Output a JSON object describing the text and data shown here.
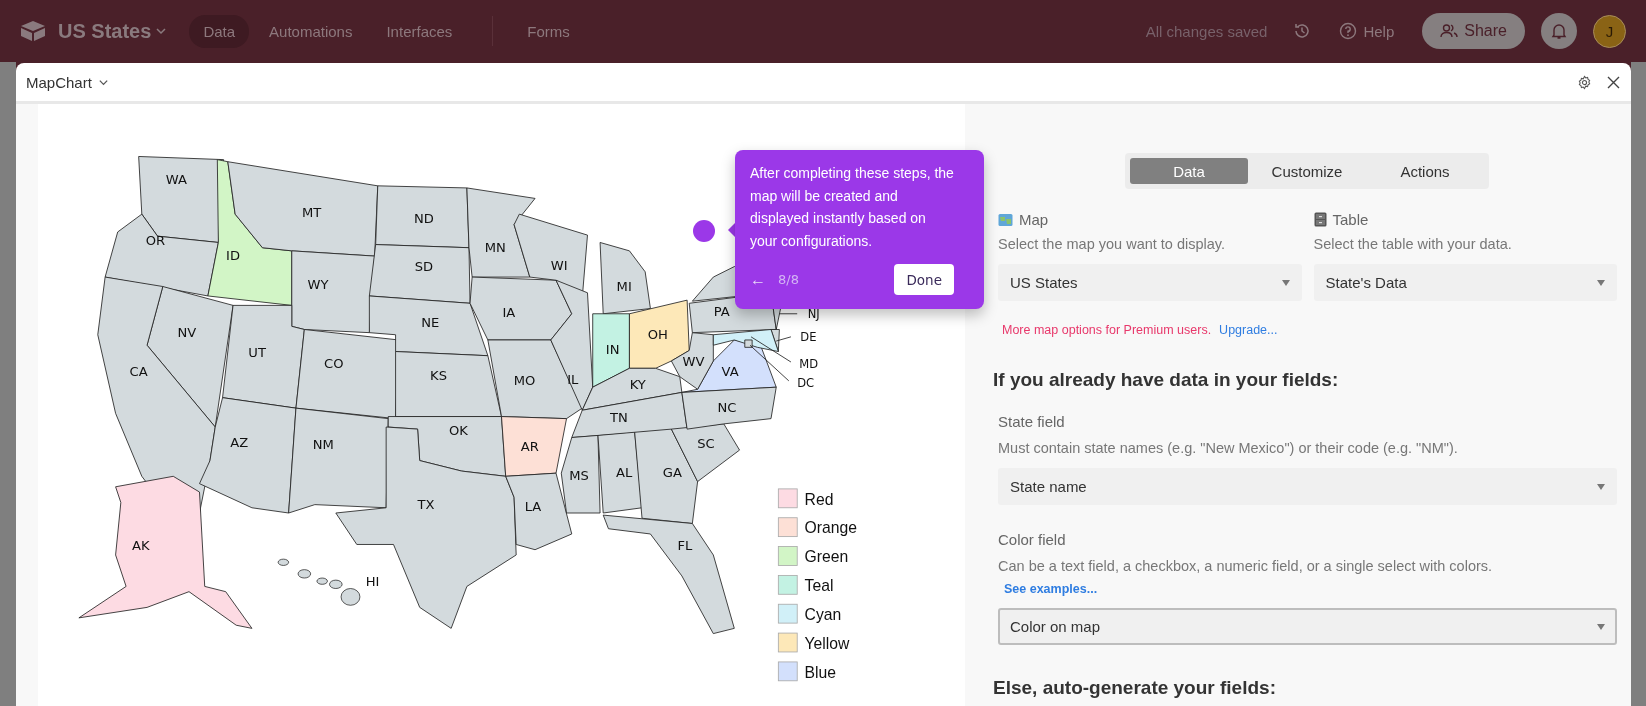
{
  "topbar": {
    "base_name": "US States",
    "nav": [
      {
        "label": "Data",
        "selected": true
      },
      {
        "label": "Automations",
        "selected": false
      },
      {
        "label": "Interfaces",
        "selected": false
      },
      {
        "label": "Forms",
        "selected": false
      }
    ],
    "save_status": "All changes saved",
    "help": "Help",
    "share": "Share",
    "avatar": "J"
  },
  "extension": {
    "title": "MapChart"
  },
  "states": [
    {
      "code": "WA",
      "color": "#d3dadd",
      "kind": "label"
    },
    {
      "code": "OR",
      "color": "#d3dadd",
      "kind": "label"
    },
    {
      "code": "ID",
      "color": "#d2f5c6",
      "kind": "label"
    },
    {
      "code": "MT",
      "color": "#d3dadd",
      "kind": "label"
    },
    {
      "code": "WY",
      "color": "#d3dadd",
      "kind": "label"
    },
    {
      "code": "NV",
      "color": "#d3dadd",
      "kind": "label"
    },
    {
      "code": "CA",
      "color": "#d3dadd",
      "kind": "label"
    },
    {
      "code": "UT",
      "color": "#d3dadd",
      "kind": "label"
    },
    {
      "code": "CO",
      "color": "#d3dadd",
      "kind": "label"
    },
    {
      "code": "AZ",
      "color": "#d3dadd",
      "kind": "label"
    },
    {
      "code": "NM",
      "color": "#d3dadd",
      "kind": "label"
    },
    {
      "code": "ND",
      "color": "#d3dadd",
      "kind": "label"
    },
    {
      "code": "SD",
      "color": "#d3dadd",
      "kind": "label"
    },
    {
      "code": "NE",
      "color": "#d3dadd",
      "kind": "label"
    },
    {
      "code": "KS",
      "color": "#d3dadd",
      "kind": "label"
    },
    {
      "code": "OK",
      "color": "#d3dadd",
      "kind": "label"
    },
    {
      "code": "TX",
      "color": "#d3dadd",
      "kind": "label"
    },
    {
      "code": "MN",
      "color": "#d3dadd",
      "kind": "label"
    },
    {
      "code": "IA",
      "color": "#d3dadd",
      "kind": "label"
    },
    {
      "code": "MO",
      "color": "#d3dadd",
      "kind": "label"
    },
    {
      "code": "AR",
      "color": "#fde0d6",
      "kind": "label"
    },
    {
      "code": "LA",
      "color": "#d3dadd",
      "kind": "label"
    },
    {
      "code": "WI",
      "color": "#d3dadd",
      "kind": "label"
    },
    {
      "code": "IL",
      "color": "#d3dadd",
      "kind": "label"
    },
    {
      "code": "MI",
      "color": "#d3dadd",
      "kind": "label"
    },
    {
      "code": "IN",
      "color": "#c3f2e3",
      "kind": "label"
    },
    {
      "code": "OH",
      "color": "#fde8b8",
      "kind": "label"
    },
    {
      "code": "KY",
      "color": "#d3dadd",
      "kind": "label"
    },
    {
      "code": "TN",
      "color": "#d3dadd",
      "kind": "label"
    },
    {
      "code": "MS",
      "color": "#d3dadd",
      "kind": "label"
    },
    {
      "code": "AL",
      "color": "#d3dadd",
      "kind": "label"
    },
    {
      "code": "GA",
      "color": "#d3dadd",
      "kind": "label"
    },
    {
      "code": "FL",
      "color": "#d3dadd",
      "kind": "label"
    },
    {
      "code": "SC",
      "color": "#d3dadd",
      "kind": "label"
    },
    {
      "code": "VA",
      "color": "#d3e0fc",
      "kind": "label"
    },
    {
      "code": "NC",
      "color": "#d3dadd",
      "kind": "label"
    },
    {
      "code": "WV",
      "color": "#d3dadd",
      "kind": "label"
    },
    {
      "code": "PA",
      "color": "#d3dadd",
      "kind": "label"
    },
    {
      "code": "NJ",
      "color": "#d3dadd",
      "kind": "callout"
    },
    {
      "code": "DE",
      "color": "#d3dadd",
      "kind": "callout"
    },
    {
      "code": "MD",
      "color": "#d1f0f8",
      "kind": "callout"
    },
    {
      "code": "DC",
      "color": "#d3dadd",
      "kind": "callout"
    },
    {
      "code": "AK",
      "color": "#fddbe3",
      "kind": "label"
    },
    {
      "code": "HI",
      "color": "#d3dadd",
      "kind": "label"
    }
  ],
  "legend": [
    {
      "label": "Red",
      "color": "#fddbe3"
    },
    {
      "label": "Orange",
      "color": "#fde0d6"
    },
    {
      "label": "Green",
      "color": "#d2f5c6"
    },
    {
      "label": "Teal",
      "color": "#c3f2e3"
    },
    {
      "label": "Cyan",
      "color": "#d1f0f8"
    },
    {
      "label": "Yellow",
      "color": "#fde8b8"
    },
    {
      "label": "Blue",
      "color": "#d3e0fc"
    }
  ],
  "tour": {
    "text": "After completing these steps, the map will be created and displayed instantly based on your configurations.",
    "back": "←",
    "step": "8/8",
    "done": "Done"
  },
  "panel": {
    "tabs": [
      {
        "label": "Data",
        "selected": true
      },
      {
        "label": "Customize",
        "selected": false
      },
      {
        "label": "Actions",
        "selected": false
      }
    ],
    "selectors": [
      {
        "label": "Map",
        "description": "Select the map you want to display.",
        "value": "US States"
      },
      {
        "label": "Table",
        "description": "Select the table with your data.",
        "value": "State's Data"
      }
    ],
    "premium_note": "More map options for Premium users.",
    "upgrade_link": "Upgrade...",
    "heading_existing": "If you already have data in your fields:",
    "state_field": {
      "label": "State field",
      "description": "Must contain state names (e.g. \"New Mexico\") or their code (e.g. \"NM\").",
      "value": "State name",
      "focused": false
    },
    "color_field": {
      "label": "Color field",
      "description": "Can be a text field, a checkbox, a numeric field, or a single select with colors.",
      "link": "See examples...",
      "value": "Color on map",
      "focused": true
    },
    "heading_generate": "Else, auto-generate your fields:"
  }
}
